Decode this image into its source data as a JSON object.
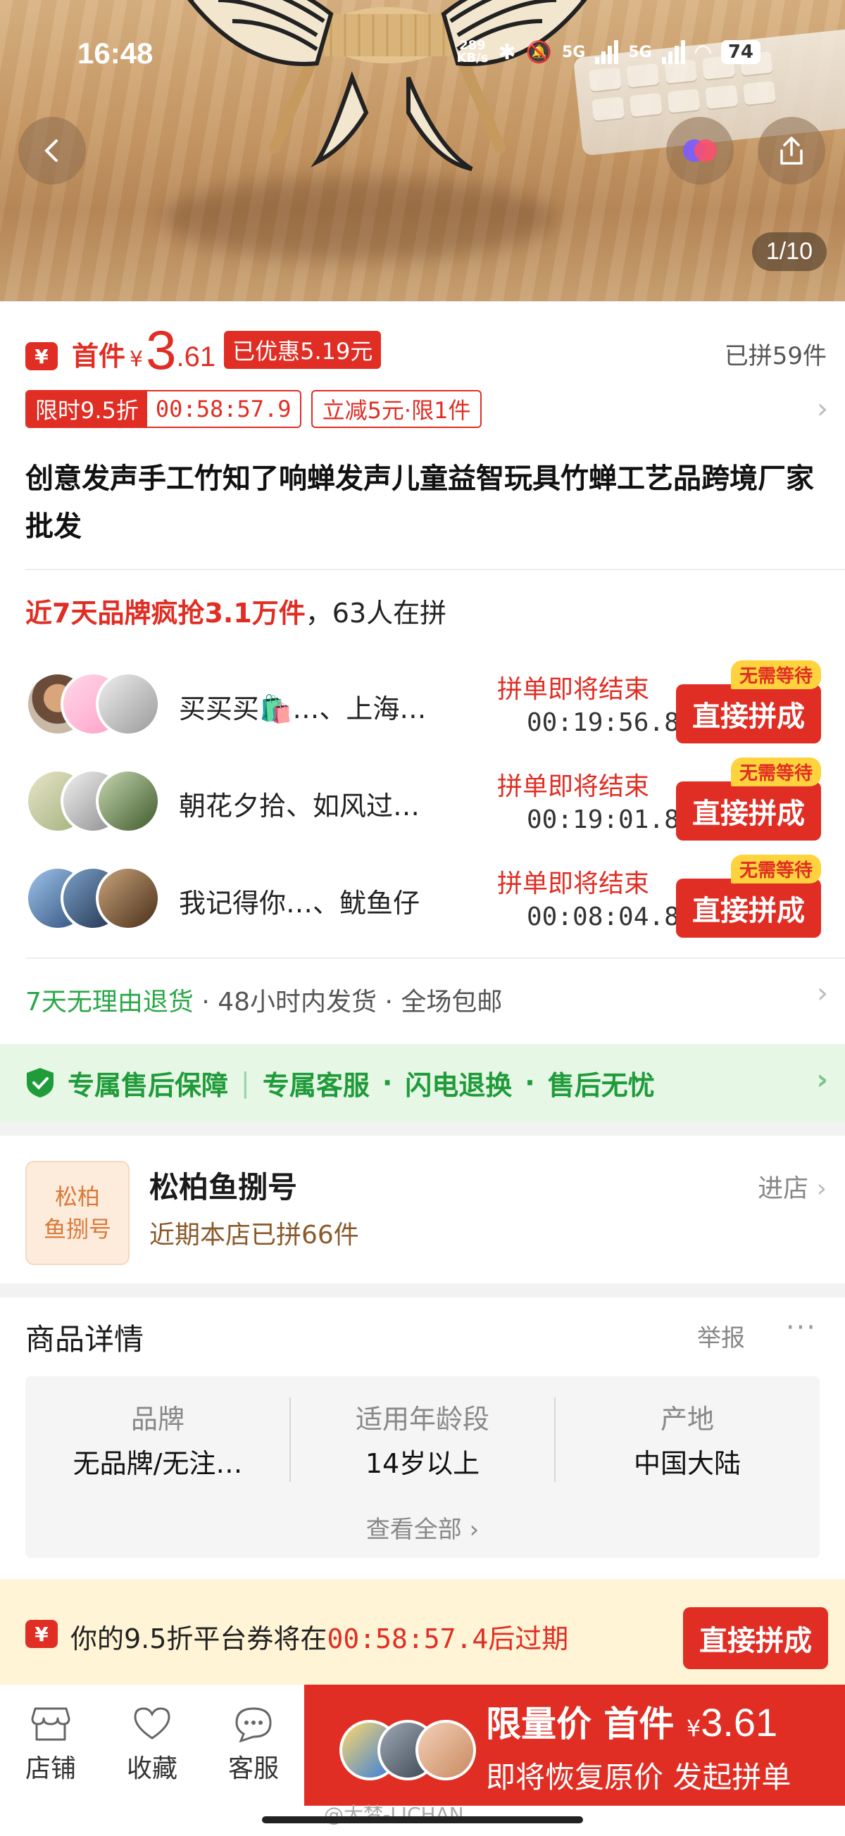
{
  "status": {
    "time": "16:48",
    "speed": "289\nKB/s",
    "net1": "5G",
    "net2": "5G",
    "battery": "74"
  },
  "hero": {
    "pager": "1/10"
  },
  "price": {
    "badge": "¥",
    "prefix": "首件",
    "currency": "¥",
    "integer": "3",
    "decimal": ".61",
    "discount": "已优惠5.19元",
    "sold": "已拼59件"
  },
  "promo": {
    "limit_label": "限时9.5折",
    "limit_timer": "00:58:57.9",
    "coupon": "立减5元·限1件"
  },
  "title": "创意发声手工竹知了响蝉发声儿童益智玩具竹蝉工艺品跨境厂家批发",
  "hot": {
    "highlight": "近7天品牌疯抢3.1万件",
    "rest": "，63人在拼"
  },
  "groups": [
    {
      "names": "买买买🛍️…、上海…",
      "ending": "拼单即将结束",
      "timer": "00:19:56.8",
      "tag": "无需等待",
      "button": "直接拼成"
    },
    {
      "names": "朝花夕拾、如风过…",
      "ending": "拼单即将结束",
      "timer": "00:19:01.8",
      "tag": "无需等待",
      "button": "直接拼成"
    },
    {
      "names": "我记得你…、鱿鱼仔",
      "ending": "拼单即将结束",
      "timer": "00:08:04.8",
      "tag": "无需等待",
      "button": "直接拼成"
    }
  ],
  "service": {
    "return": "7天无理由退货",
    "ship": " · 48小时内发货 · 全场包邮"
  },
  "guarantee": {
    "a": "专属售后保障",
    "b": "专属客服",
    "c": "闪电退换",
    "d": "售后无忧"
  },
  "shop": {
    "logo_line1": "松柏",
    "logo_line2": "鱼捌号",
    "name": "松柏鱼捌号",
    "stat": "近期本店已拼66件",
    "enter": "进店"
  },
  "detail": {
    "heading": "商品详情",
    "report": "举报",
    "more": "···",
    "specs": [
      {
        "key": "品牌",
        "value": "无品牌/无注…"
      },
      {
        "key": "适用年龄段",
        "value": "14岁以上"
      },
      {
        "key": "产地",
        "value": "中国大陆"
      }
    ],
    "view_all": "查看全部 ›"
  },
  "coupon_bar": {
    "icon": "¥",
    "text_a": "你的9.5折平台券将在",
    "timer": "00:58:57.4",
    "text_b": "后过期",
    "button": "直接拼成"
  },
  "bottom": {
    "store": "店铺",
    "favorite": "收藏",
    "service": "客服",
    "buy_line1_a": "限量价 首件 ",
    "buy_currency": "¥",
    "buy_price": "3.61",
    "buy_line2": "即将恢复原价 发起拼单"
  },
  "watermark": "@大梦-LICHAN",
  "colors": {
    "accent": "#e02e24",
    "green": "#1f9b3a",
    "coupon_bg": "#fff4d6",
    "nowait": "#ffd33d"
  }
}
